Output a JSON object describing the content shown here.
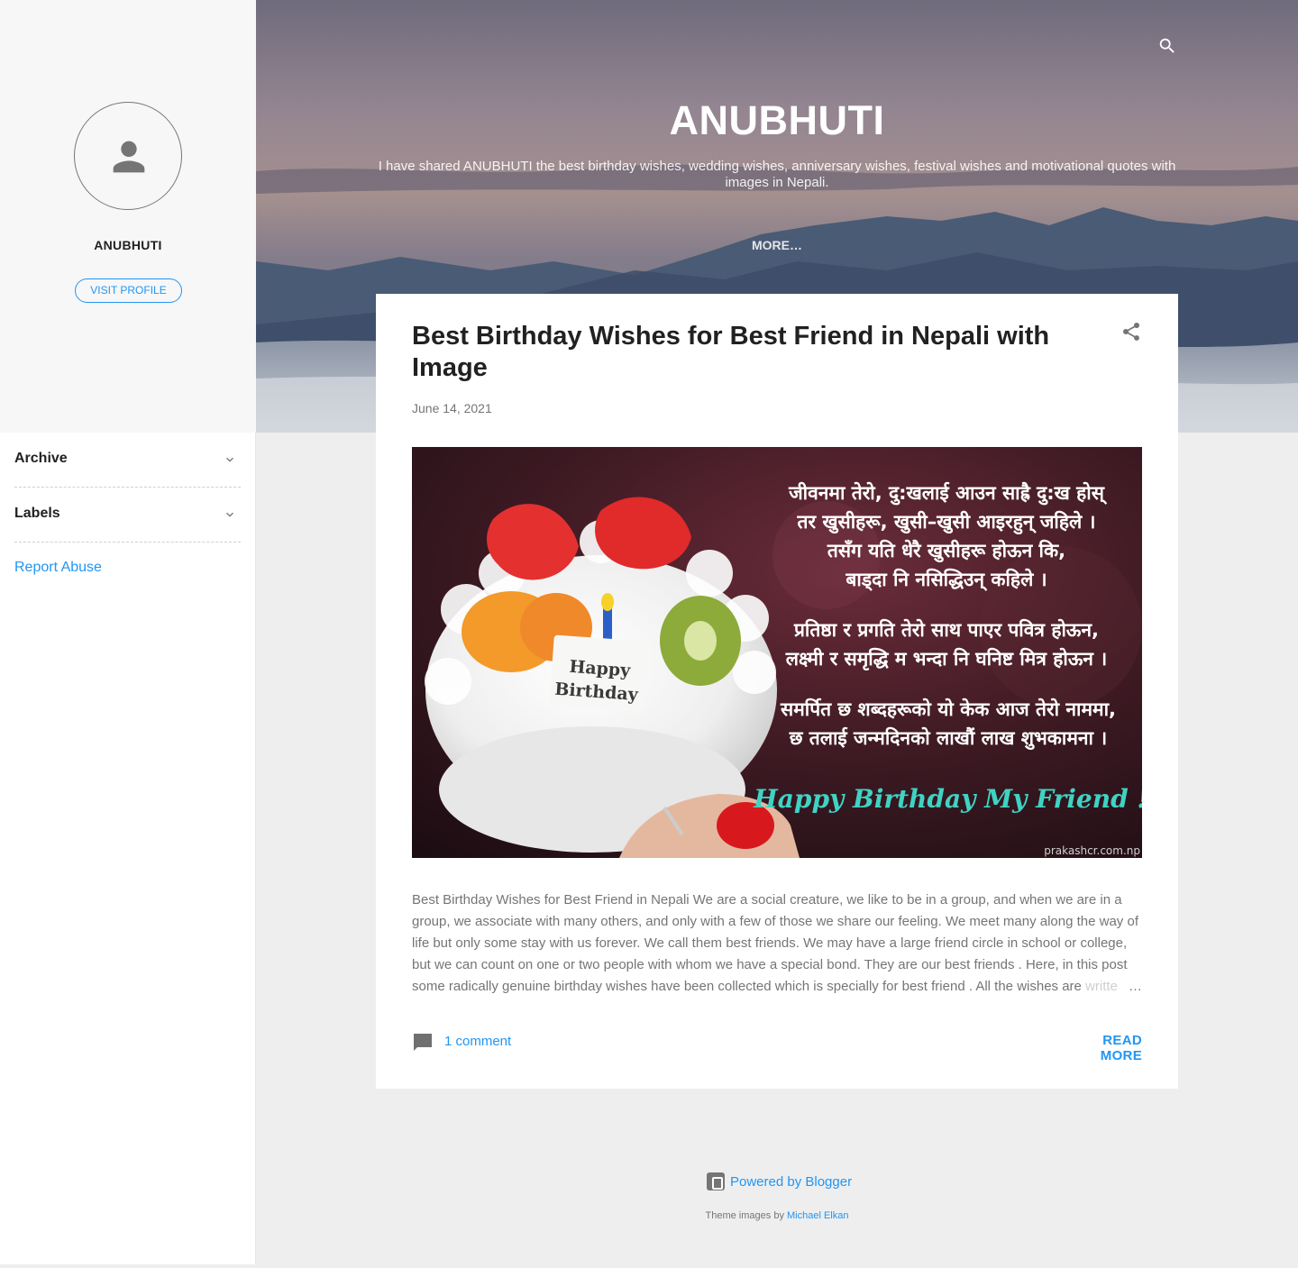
{
  "sidebar": {
    "profile_name": "ANUBHUTI",
    "visit_profile_label": "VISIT PROFILE",
    "widgets": [
      {
        "label": "Archive",
        "icon": "chevron-down-icon"
      },
      {
        "label": "Labels",
        "icon": "chevron-down-icon"
      }
    ],
    "report_abuse_label": "Report Abuse"
  },
  "header": {
    "title": "ANUBHUTI",
    "description": "I have shared ANUBHUTI the best birthday wishes, wedding wishes, anniversary wishes, festival wishes and motivational quotes with images in Nepali.",
    "more_label": "MORE…",
    "search_icon": "search-icon"
  },
  "post": {
    "title": "Best Birthday Wishes for Best Friend in Nepali with Image",
    "date": "June 14, 2021",
    "image": {
      "poem_lines": [
        "जीवनमा तेरो, दु:खलाई आउन साह्रै दु:ख होस्",
        "तर खुसीहरू, खुसी–खुसी आइरहुन् जहिले ।",
        "तसँग यति धेरै खुसीहरू होऊन कि,",
        "बाड्दा नि नसिद्धिउन् कहिले ।",
        "प्रतिष्ठा र प्रगति तेरो साथ पाएर पवित्र होऊन,",
        "लक्ष्मी र समृद्धि म भन्दा नि घनिष्ट मित्र होऊन ।",
        "समर्पित छ शब्दहरूको यो केक आज तेरो नाममा,",
        "छ तलाई जन्मदिनको लाखौं लाख शुभकामना ।"
      ],
      "greeting": "Happy Birthday My Friend !",
      "card_text_1": "Happy",
      "card_text_2": "Birthday",
      "watermark": "prakashcr.com.np"
    },
    "snippet_lines": [
      "Best Birthday Wishes for Best Friend in Nepali    We are a social creature, we like to be in a group, and when we are in a",
      "group, we associate with many others, and only with a few of those we share our feeling. We meet many along the way of",
      "life but only some stay with us forever. We call them best friends. We may have a large friend circle in school or college,",
      "but we can count on one or two people with whom we have a special bond. They are our best friends .   Here, in this post",
      "some radically genuine birthday wishes have been collected which is specially for best friend . All the wishes are "
    ],
    "snippet_fade": "writte",
    "ellipsis": "…",
    "comments_label": "1 comment",
    "read_more_label": "READ MORE"
  },
  "footer": {
    "powered_by": "Powered by Blogger",
    "theme_credit_prefix": "Theme images by ",
    "theme_credit_author": "Michael Elkan"
  },
  "colors": {
    "accent": "#2196f3",
    "text": "#212121",
    "muted": "#757575",
    "page_bg": "#eeeeee",
    "sidebar_profile_bg": "#f7f7f7"
  }
}
